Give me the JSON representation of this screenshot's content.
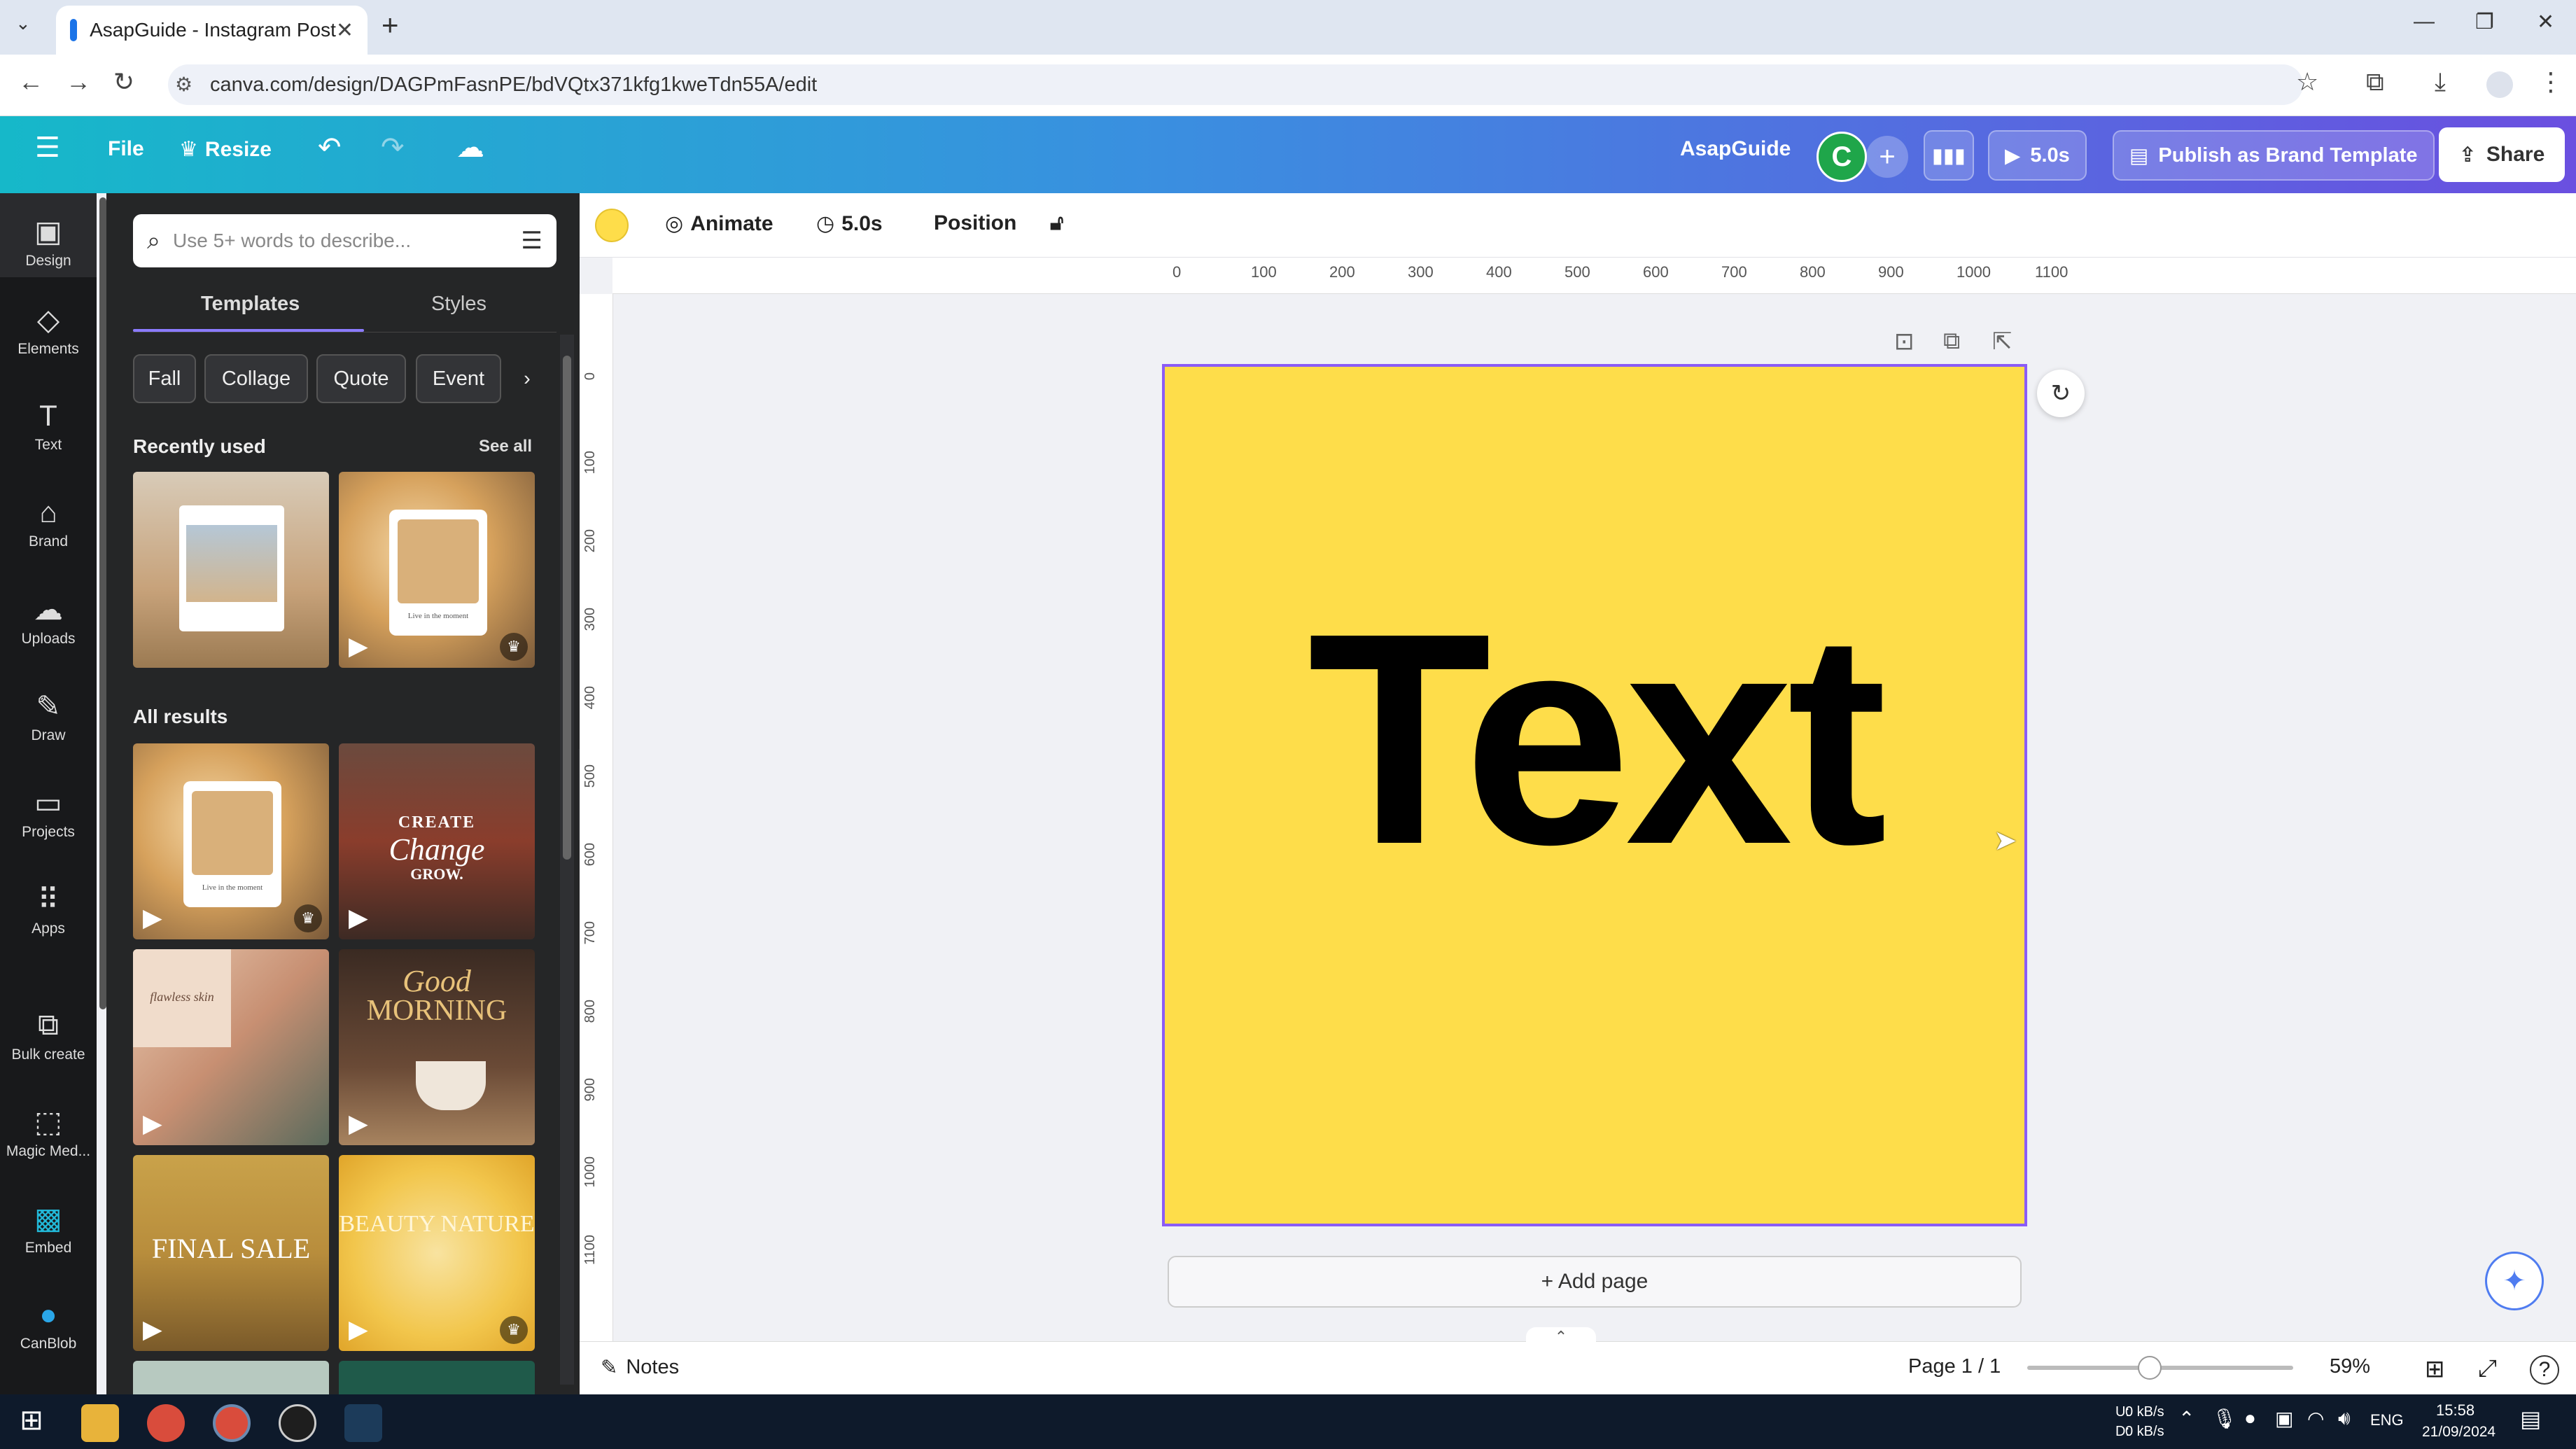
{
  "browser": {
    "tab_title": "AsapGuide - Instagram Post",
    "url": "canva.com/design/DAGPmFasnPE/bdVQtx371kfg1kweTdn55A/edit"
  },
  "header": {
    "file": "File",
    "resize": "Resize",
    "brand": "AsapGuide",
    "avatar_letter": "C",
    "play_time": "5.0s",
    "publish": "Publish as Brand Template",
    "share": "Share"
  },
  "rail": [
    {
      "label": "Design",
      "icon": "design-icon"
    },
    {
      "label": "Elements",
      "icon": "elements-icon"
    },
    {
      "label": "Text",
      "icon": "text-icon"
    },
    {
      "label": "Brand",
      "icon": "brand-icon"
    },
    {
      "label": "Uploads",
      "icon": "uploads-icon"
    },
    {
      "label": "Draw",
      "icon": "draw-icon"
    },
    {
      "label": "Projects",
      "icon": "projects-icon"
    },
    {
      "label": "Apps",
      "icon": "apps-icon"
    },
    {
      "label": "Bulk create",
      "icon": "bulk-create-icon"
    },
    {
      "label": "Magic Med...",
      "icon": "magic-media-icon"
    },
    {
      "label": "Embed",
      "icon": "embed-icon"
    },
    {
      "label": "CanBlob",
      "icon": "canblob-icon"
    }
  ],
  "panel": {
    "search_placeholder": "Use 5+ words to describe...",
    "tabs": [
      "Templates",
      "Styles"
    ],
    "chips": [
      "Fall",
      "Collage",
      "Quote",
      "Event"
    ],
    "recently_used": "Recently used",
    "see_all": "See all",
    "all_results": "All results",
    "thumbs": {
      "live1": "Live in the moment",
      "live2": "Live in the moment",
      "create1": "CREATE",
      "create2": "Change",
      "create3": "GROW.",
      "flawless": "flawless skin",
      "good": "Good",
      "morning": "MORNING",
      "final": "FINAL SALE",
      "beauty": "BEAUTY NATURE"
    }
  },
  "toolbar": {
    "animate": "Animate",
    "duration": "5.0s",
    "position": "Position",
    "swatch_color": "#fedd4a"
  },
  "ruler": {
    "h": [
      "0",
      "100",
      "200",
      "300",
      "400",
      "500",
      "600",
      "700",
      "800",
      "900",
      "1000",
      "1100"
    ],
    "v": [
      "0",
      "100",
      "200",
      "300",
      "400",
      "500",
      "600",
      "700",
      "800",
      "900",
      "1000",
      "1100"
    ]
  },
  "canvas": {
    "text": "Text",
    "add_page": "+ Add page",
    "bg_color": "#fedd4a"
  },
  "bottom": {
    "notes": "Notes",
    "page": "Page 1 / 1",
    "zoom": "59%"
  },
  "taskbar": {
    "net1": "0 kB/s",
    "net2": "0 kB/s",
    "net_u": "U:",
    "net_d": "D:",
    "lang": "ENG",
    "time": "15:58",
    "date": "21/09/2024"
  }
}
